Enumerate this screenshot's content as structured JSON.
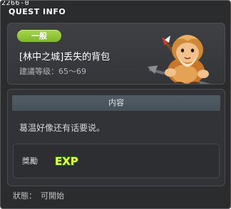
{
  "window": {
    "quest_id": "2266-0",
    "title": "QUEST INFO"
  },
  "quest": {
    "type_badge": "一般",
    "name": "[林中之城]丢失的背包",
    "recommended_level": "建議等级：65～69"
  },
  "content": {
    "header": "内容",
    "description": "葛温好像还有话要说。"
  },
  "reward": {
    "label": "獎勵",
    "exp_icon_text": "EXP"
  },
  "status": {
    "label": "狀態：",
    "value": "可開始"
  },
  "icons": {
    "npc": "npc-portrait-icon",
    "exp": "exp-icon"
  },
  "colors": {
    "badge_green": "#8cc63f",
    "exp_text": "#e6ff3a"
  }
}
